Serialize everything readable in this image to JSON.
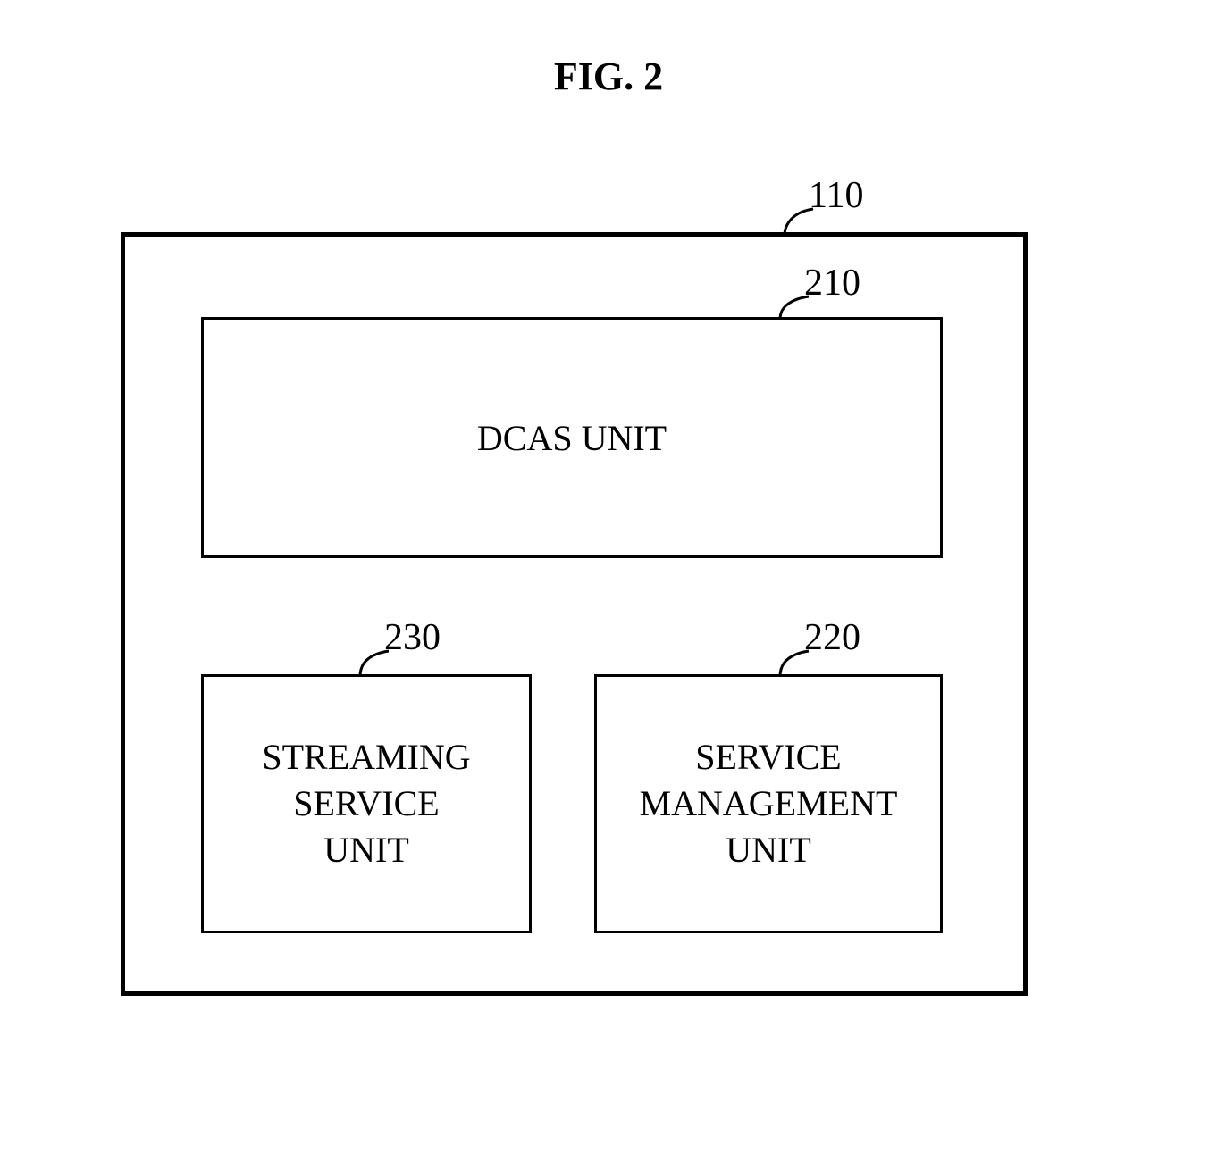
{
  "figure": {
    "title": "FIG. 2"
  },
  "refs": {
    "outer": "110",
    "dcas": "210",
    "streaming": "230",
    "service_mgmt": "220"
  },
  "boxes": {
    "dcas": "DCAS UNIT",
    "streaming": "STREAMING\nSERVICE\nUNIT",
    "service_mgmt": "SERVICE\nMANAGEMENT\nUNIT"
  }
}
